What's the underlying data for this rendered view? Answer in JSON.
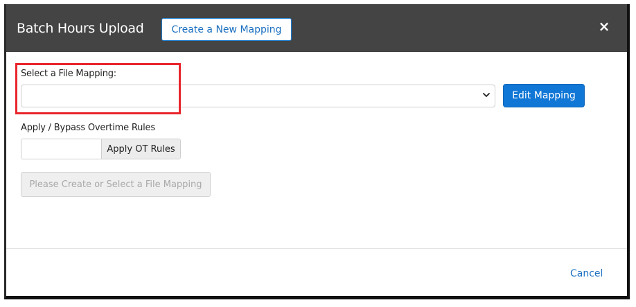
{
  "dialog": {
    "title": "Batch Hours Upload",
    "create_mapping_label": "Create a New Mapping",
    "close_label": "×"
  },
  "mapping": {
    "label": "Select a File Mapping:",
    "selected_value": "",
    "edit_label": "Edit Mapping"
  },
  "overtime": {
    "label": "Apply / Bypass Overtime Rules",
    "input_value": "",
    "apply_label": "Apply OT Rules"
  },
  "upload": {
    "disabled_label": "Please Create or Select a File Mapping"
  },
  "footer": {
    "cancel_label": "Cancel"
  },
  "colors": {
    "header_bg": "#444444",
    "accent": "#1177d6",
    "highlight": "#e8252b"
  },
  "icons": {
    "close": "close-icon",
    "dropdown": "chevron-down-icon"
  }
}
